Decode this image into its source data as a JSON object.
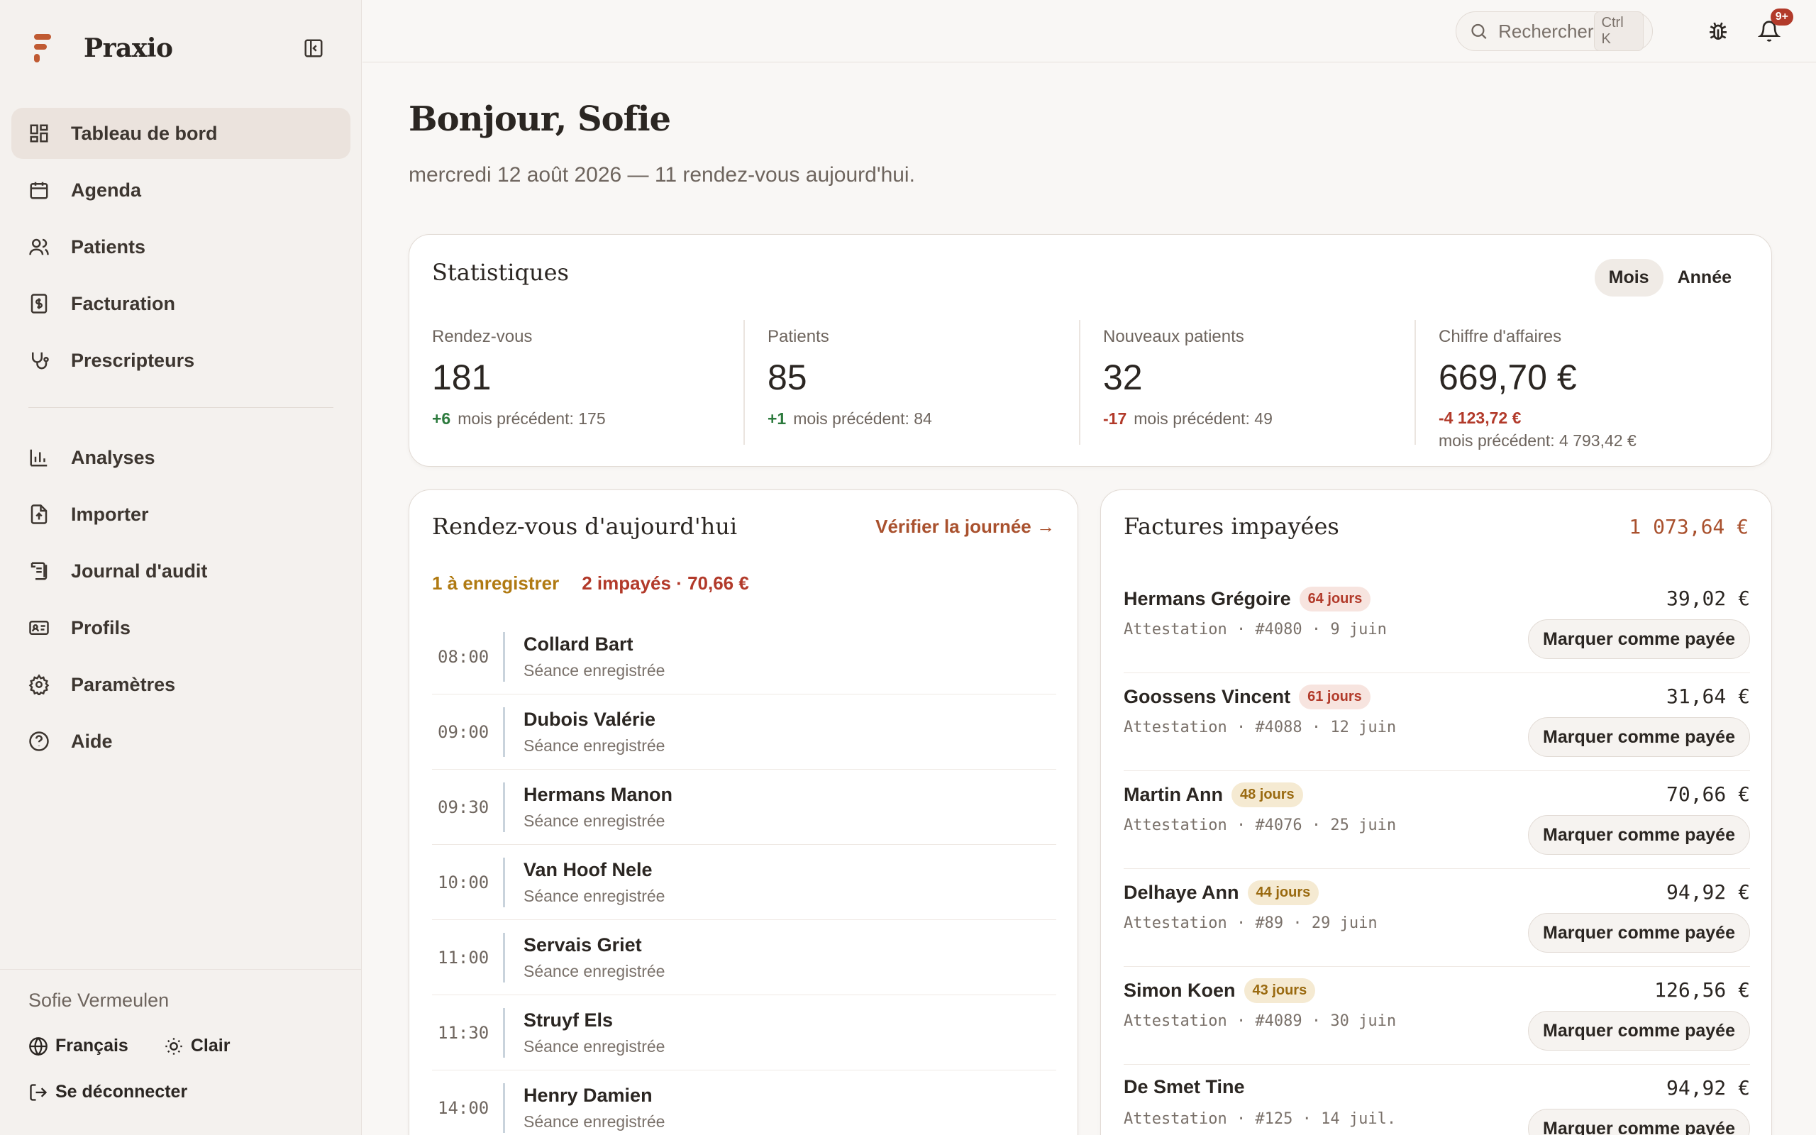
{
  "app": {
    "name": "Praxio"
  },
  "sidebar": {
    "items": [
      {
        "label": "Tableau de bord",
        "icon": "dashboard-icon"
      },
      {
        "label": "Agenda",
        "icon": "calendar-icon"
      },
      {
        "label": "Patients",
        "icon": "users-icon"
      },
      {
        "label": "Facturation",
        "icon": "invoice-icon"
      },
      {
        "label": "Prescripteurs",
        "icon": "stethoscope-icon"
      },
      {
        "label": "Analyses",
        "icon": "bar-chart-icon"
      },
      {
        "label": "Importer",
        "icon": "upload-file-icon"
      },
      {
        "label": "Journal d'audit",
        "icon": "scroll-icon"
      },
      {
        "label": "Profils",
        "icon": "id-card-icon"
      },
      {
        "label": "Paramètres",
        "icon": "gear-icon"
      },
      {
        "label": "Aide",
        "icon": "help-icon"
      }
    ],
    "user": "Sofie Vermeulen",
    "language": "Français",
    "theme": "Clair",
    "logout": "Se déconnecter"
  },
  "topbar": {
    "search_placeholder": "Rechercher",
    "search_shortcut": "Ctrl K",
    "notifications_badge": "9+"
  },
  "main": {
    "greeting": "Bonjour, Sofie",
    "subtitle": "mercredi 12 août 2026 — 11 rendez-vous aujourd'hui."
  },
  "stats": {
    "title": "Statistiques",
    "period_options": [
      "Mois",
      "Année"
    ],
    "period_selected": "Mois",
    "items": [
      {
        "label": "Rendez-vous",
        "value": "181",
        "delta": "+6",
        "previous": "mois précédent: 175"
      },
      {
        "label": "Patients",
        "value": "85",
        "delta": "+1",
        "previous": "mois précédent: 84"
      },
      {
        "label": "Nouveaux patients",
        "value": "32",
        "delta": "-17",
        "previous": "mois précédent: 49"
      },
      {
        "label": "Chiffre d'affaires",
        "value": "669,70 €",
        "delta": "-4 123,72 €",
        "previous": "mois précédent: 4 793,42 €"
      }
    ]
  },
  "appointments": {
    "title": "Rendez-vous d'aujourd'hui",
    "link": "Vérifier la journée →",
    "to_record": "1 à enregistrer",
    "unpaid": "2 impayés · 70,66 €",
    "rows": [
      {
        "time": "08:00",
        "name": "Collard Bart",
        "status": "Séance enregistrée"
      },
      {
        "time": "09:00",
        "name": "Dubois Valérie",
        "status": "Séance enregistrée"
      },
      {
        "time": "09:30",
        "name": "Hermans Manon",
        "status": "Séance enregistrée"
      },
      {
        "time": "10:00",
        "name": "Van Hoof Nele",
        "status": "Séance enregistrée"
      },
      {
        "time": "11:00",
        "name": "Servais Griet",
        "status": "Séance enregistrée"
      },
      {
        "time": "11:30",
        "name": "Struyf Els",
        "status": "Séance enregistrée"
      },
      {
        "time": "14:00",
        "name": "Henry Damien",
        "status": "Séance enregistrée"
      }
    ]
  },
  "invoices": {
    "title": "Factures impayées",
    "total": "1 073,64 €",
    "button_label": "Marquer comme payée",
    "rows": [
      {
        "name": "Hermans Grégoire",
        "days": "64 jours",
        "severity": "red",
        "meta": "Attestation · #4080 · 9 juin",
        "amount": "39,02 €"
      },
      {
        "name": "Goossens Vincent",
        "days": "61 jours",
        "severity": "red",
        "meta": "Attestation · #4088 · 12 juin",
        "amount": "31,64 €"
      },
      {
        "name": "Martin Ann",
        "days": "48 jours",
        "severity": "amber",
        "meta": "Attestation · #4076 · 25 juin",
        "amount": "70,66 €"
      },
      {
        "name": "Delhaye Ann",
        "days": "44 jours",
        "severity": "amber",
        "meta": "Attestation · #89 · 29 juin",
        "amount": "94,92 €"
      },
      {
        "name": "Simon Koen",
        "days": "43 jours",
        "severity": "amber",
        "meta": "Attestation · #4089 · 30 juin",
        "amount": "126,56 €"
      },
      {
        "name": "De Smet Tine",
        "days": "",
        "severity": "",
        "meta": "Attestation · #125 · 14 juil.",
        "amount": "94,92 €"
      }
    ]
  },
  "colors": {
    "accent": "#a9512e",
    "positive": "#2c7a3d",
    "negative": "#b23a2a",
    "warning": "#b07a12"
  }
}
